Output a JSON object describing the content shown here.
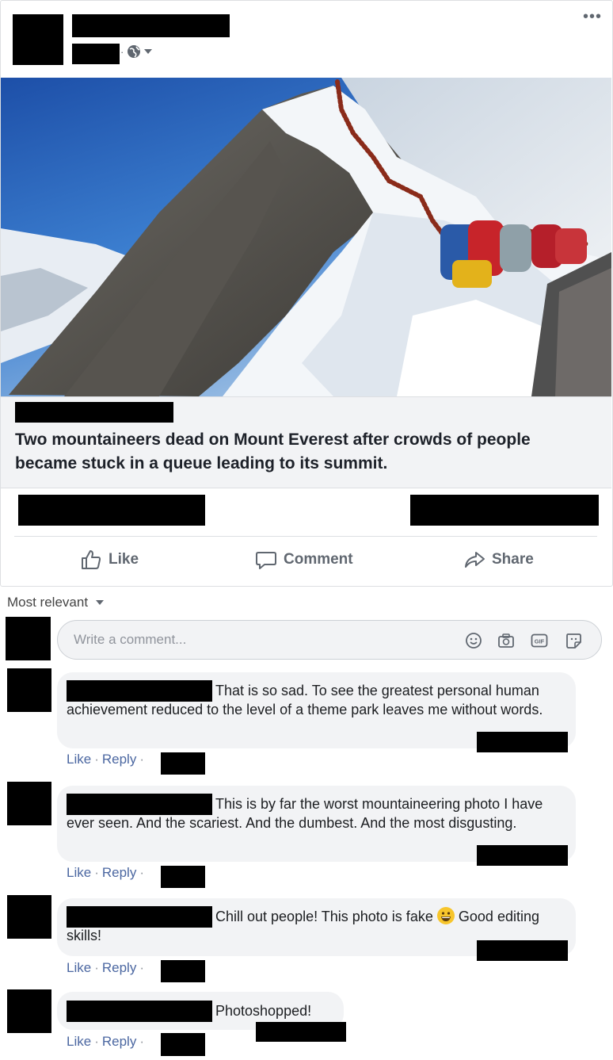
{
  "post": {
    "more_label": "•••",
    "caption": "Two mountaineers dead on Mount Everest after crowds of people became stuck in a queue leading to its summit.",
    "actions": {
      "like": "Like",
      "comment": "Comment",
      "share": "Share"
    }
  },
  "comments_section": {
    "sort_label": "Most relevant",
    "input_placeholder": "Write a comment...",
    "gif_label": "GIF"
  },
  "comments": [
    {
      "text_line1": "That is so sad. To see the greatest personal",
      "text_rest": "human achievement reduced to the level of a theme park leaves me without words.",
      "like": "Like",
      "reply": "Reply"
    },
    {
      "text_line1": "This is by far the worst mountaineering photo",
      "text_rest": "I have ever seen. And the scariest. And the dumbest. And the most disgusting.",
      "like": "Like",
      "reply": "Reply"
    },
    {
      "text_line1": "Chill out people! This photo is fake",
      "text_line1b": "Good",
      "text_rest": "editing skills!",
      "like": "Like",
      "reply": "Reply"
    },
    {
      "text_line1": "Photoshopped!",
      "like": "Like",
      "reply": "Reply"
    }
  ],
  "colors": {
    "link": "#4b67a1",
    "bubble": "#f2f3f5",
    "caption_bg": "#f2f3f5"
  }
}
